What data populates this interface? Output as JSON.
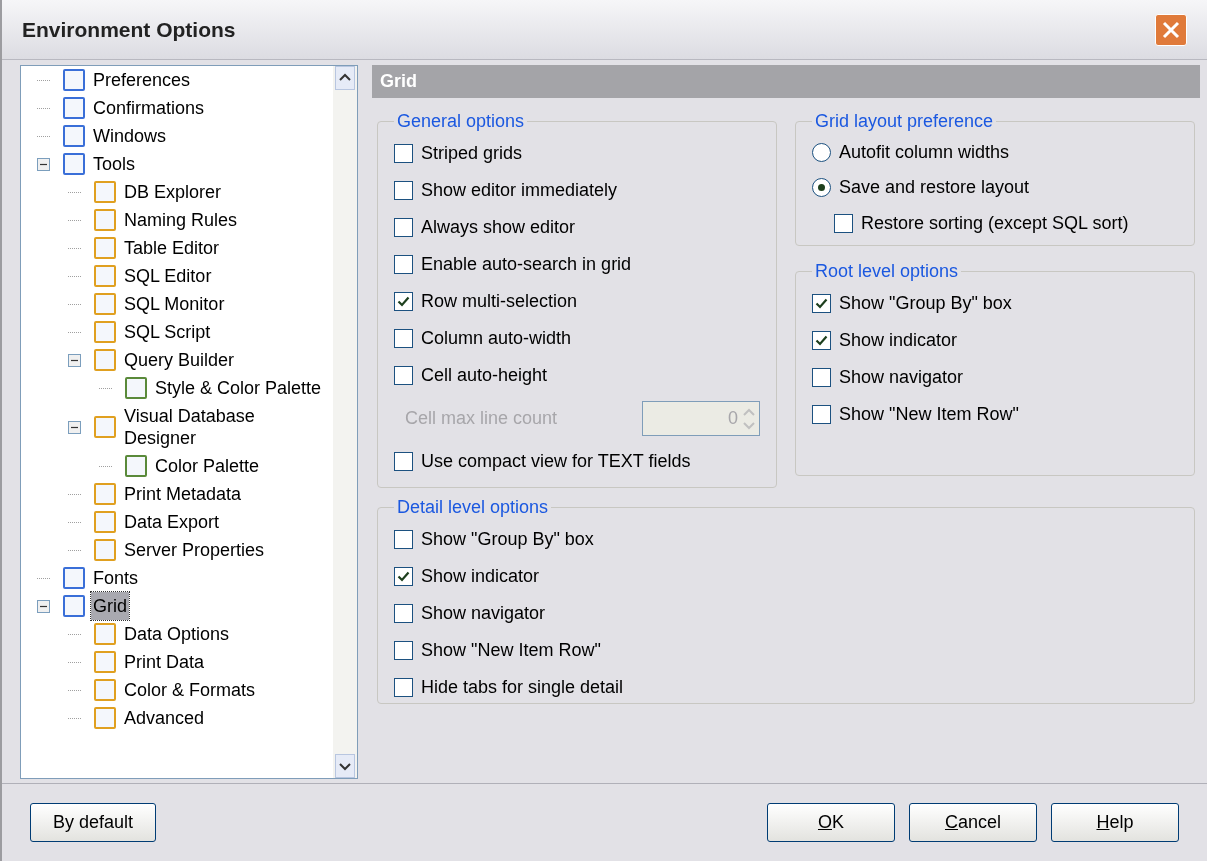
{
  "window": {
    "title": "Environment Options"
  },
  "tree": [
    {
      "label": "Preferences",
      "selected": false
    },
    {
      "label": "Confirmations",
      "selected": false
    },
    {
      "label": "Windows",
      "selected": false
    },
    {
      "label": "Tools",
      "selected": false,
      "expanded": true,
      "children": [
        {
          "label": "DB Explorer",
          "selected": false
        },
        {
          "label": "Naming Rules",
          "selected": false
        },
        {
          "label": "Table Editor",
          "selected": false
        },
        {
          "label": "SQL Editor",
          "selected": false
        },
        {
          "label": "SQL Monitor",
          "selected": false
        },
        {
          "label": "SQL Script",
          "selected": false
        },
        {
          "label": "Query Builder",
          "selected": false,
          "expanded": true,
          "children": [
            {
              "label": "Style & Color Palette",
              "selected": false
            }
          ]
        },
        {
          "label": "Visual Database Designer",
          "selected": false,
          "expanded": true,
          "children": [
            {
              "label": "Color Palette",
              "selected": false
            }
          ]
        },
        {
          "label": "Print Metadata",
          "selected": false
        },
        {
          "label": "Data Export",
          "selected": false
        },
        {
          "label": "Server Properties",
          "selected": false
        }
      ]
    },
    {
      "label": "Fonts",
      "selected": false
    },
    {
      "label": "Grid",
      "selected": true,
      "expanded": true,
      "children": [
        {
          "label": "Data Options",
          "selected": false
        },
        {
          "label": "Print Data",
          "selected": false
        },
        {
          "label": "Color & Formats",
          "selected": false
        },
        {
          "label": "Advanced",
          "selected": false
        }
      ]
    }
  ],
  "header": "Grid",
  "general_options": {
    "title": "General options",
    "items": [
      {
        "kind": "checkbox",
        "label": "Striped grids",
        "checked": false
      },
      {
        "kind": "checkbox",
        "label": "Show editor immediately",
        "checked": false
      },
      {
        "kind": "checkbox",
        "label": "Always show editor",
        "checked": false
      },
      {
        "kind": "checkbox",
        "label": "Enable auto-search in grid",
        "checked": false
      },
      {
        "kind": "checkbox",
        "label": "Row multi-selection",
        "checked": true
      },
      {
        "kind": "checkbox",
        "label": "Column auto-width",
        "checked": false
      },
      {
        "kind": "checkbox",
        "label": "Cell auto-height",
        "checked": false
      },
      {
        "kind": "spin",
        "label": "Cell max line count",
        "value": "0",
        "disabled": true
      },
      {
        "kind": "checkbox",
        "label": "Use compact view for TEXT fields",
        "checked": false
      }
    ]
  },
  "grid_layout_preference": {
    "title": "Grid layout preference",
    "items": [
      {
        "kind": "radio",
        "label": "Autofit column widths",
        "selected": false
      },
      {
        "kind": "radio",
        "label": "Save and restore layout",
        "selected": true
      },
      {
        "kind": "subcheckbox",
        "label": "Restore sorting (except SQL sort)",
        "checked": false
      }
    ]
  },
  "root_level_options": {
    "title": "Root level options",
    "items": [
      {
        "kind": "checkbox",
        "label": "Show \"Group By\" box",
        "checked": true
      },
      {
        "kind": "checkbox",
        "label": "Show indicator",
        "checked": true
      },
      {
        "kind": "checkbox",
        "label": "Show navigator",
        "checked": false
      },
      {
        "kind": "checkbox",
        "label": "Show \"New Item Row\"",
        "checked": false
      }
    ]
  },
  "detail_level_options": {
    "title": "Detail level options",
    "items": [
      {
        "kind": "checkbox",
        "label": "Show \"Group By\" box",
        "checked": false
      },
      {
        "kind": "checkbox",
        "label": "Show indicator",
        "checked": true
      },
      {
        "kind": "checkbox",
        "label": "Show navigator",
        "checked": false
      },
      {
        "kind": "checkbox",
        "label": "Show \"New Item Row\"",
        "checked": false
      },
      {
        "kind": "checkbox",
        "label": "Hide tabs for single detail",
        "checked": false
      }
    ]
  },
  "buttons": {
    "left": [
      {
        "label": "By default"
      }
    ],
    "right": [
      {
        "label": "OK",
        "first_letter_underlined": true
      },
      {
        "label": "Cancel",
        "first_letter_underlined": true
      },
      {
        "label": "Help",
        "first_letter_underlined": true
      }
    ]
  }
}
